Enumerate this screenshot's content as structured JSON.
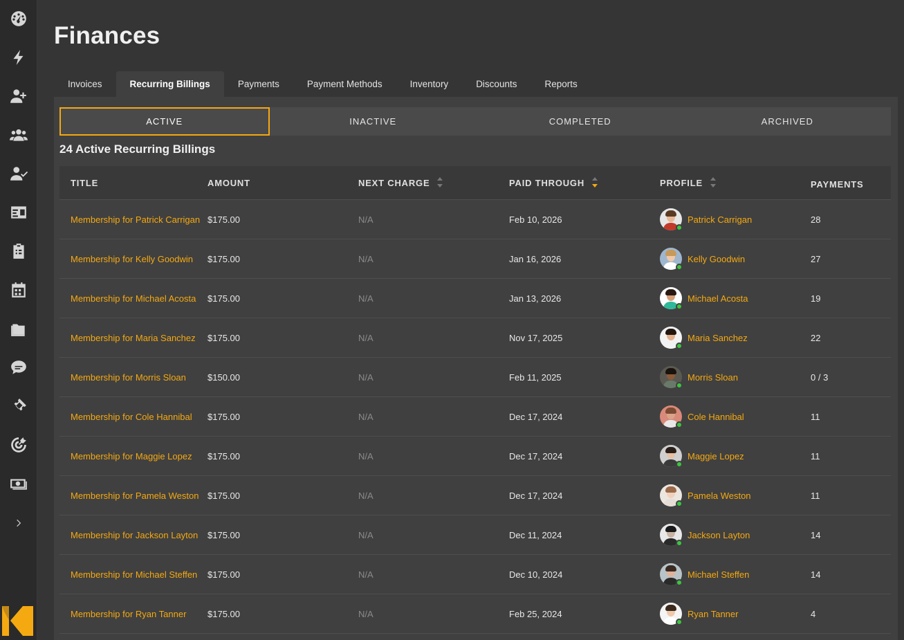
{
  "app": {
    "title": "Finances"
  },
  "sidebar": {
    "icons": [
      "dashboard-icon",
      "lightning-icon",
      "add-user-icon",
      "users-icon",
      "user-check-icon",
      "id-card-icon",
      "clipboard-icon",
      "calendar-icon",
      "folder-icon",
      "chat-icon",
      "ticket-icon",
      "target-icon",
      "money-icon",
      "chevron-right-icon"
    ]
  },
  "tabs": [
    {
      "label": "Invoices",
      "active": false
    },
    {
      "label": "Recurring Billings",
      "active": true
    },
    {
      "label": "Payments",
      "active": false
    },
    {
      "label": "Payment Methods",
      "active": false
    },
    {
      "label": "Inventory",
      "active": false
    },
    {
      "label": "Discounts",
      "active": false
    },
    {
      "label": "Reports",
      "active": false
    }
  ],
  "subtabs": [
    {
      "label": "ACTIVE",
      "active": true
    },
    {
      "label": "INACTIVE",
      "active": false
    },
    {
      "label": "COMPLETED",
      "active": false
    },
    {
      "label": "ARCHIVED",
      "active": false
    }
  ],
  "section": {
    "title": "24 Active Recurring Billings"
  },
  "table": {
    "columns": [
      "TITLE",
      "AMOUNT",
      "NEXT CHARGE",
      "PAID THROUGH",
      "PROFILE",
      "PAYMENTS"
    ],
    "rows": [
      {
        "title": "Membership for Patrick Carrigan",
        "amount": "$175.00",
        "next_charge": "N/A",
        "paid_through": "Feb 10, 2026",
        "profile": "Patrick Carrigan",
        "payments": "28",
        "skin": "#e8b896",
        "hair": "#5a3a22",
        "shirt": "#c23a2a",
        "bg": "#e6e6e6"
      },
      {
        "title": "Membership for Kelly Goodwin",
        "amount": "$175.00",
        "next_charge": "N/A",
        "paid_through": "Jan 16, 2026",
        "profile": "Kelly Goodwin",
        "payments": "27",
        "skin": "#f0c9a8",
        "hair": "#c79a5a",
        "shirt": "#ffffff",
        "bg": "#9fb6cf"
      },
      {
        "title": "Membership for Michael Acosta",
        "amount": "$175.00",
        "next_charge": "N/A",
        "paid_through": "Jan 13, 2026",
        "profile": "Michael Acosta",
        "payments": "19",
        "skin": "#d7a07a",
        "hair": "#2a1a12",
        "shirt": "#2fb89a",
        "bg": "#ffffff"
      },
      {
        "title": "Membership for Maria Sanchez",
        "amount": "$175.00",
        "next_charge": "N/A",
        "paid_through": "Nov 17, 2025",
        "profile": "Maria Sanchez",
        "payments": "22",
        "skin": "#e2b08c",
        "hair": "#221611",
        "shirt": "#f2f2f2",
        "bg": "#f2f2f2"
      },
      {
        "title": "Membership for Morris Sloan",
        "amount": "$150.00",
        "next_charge": "N/A",
        "paid_through": "Feb 11, 2025",
        "profile": "Morris Sloan",
        "payments": "0 / 3",
        "skin": "#8a5a3a",
        "hair": "#1a120c",
        "shirt": "#6a7a6a",
        "bg": "#5a5a52"
      },
      {
        "title": "Membership for Cole Hannibal",
        "amount": "$175.00",
        "next_charge": "N/A",
        "paid_through": "Dec 17, 2024",
        "profile": "Cole Hannibal",
        "payments": "11",
        "skin": "#d9a48a",
        "hair": "#7a4a32",
        "shirt": "#e8e8e8",
        "bg": "#d98a7a"
      },
      {
        "title": "Membership for Maggie Lopez",
        "amount": "$175.00",
        "next_charge": "N/A",
        "paid_through": "Dec 17, 2024",
        "profile": "Maggie Lopez",
        "payments": "11",
        "skin": "#e6c0a4",
        "hair": "#2a1e18",
        "shirt": "#3a3a3a",
        "bg": "#cfcfcf"
      },
      {
        "title": "Membership for Pamela Weston",
        "amount": "$175.00",
        "next_charge": "N/A",
        "paid_through": "Dec 17, 2024",
        "profile": "Pamela Weston",
        "payments": "11",
        "skin": "#f0d2bc",
        "hair": "#9a6a4a",
        "shirt": "#e6ded6",
        "bg": "#ece6e0"
      },
      {
        "title": "Membership for Jackson Layton",
        "amount": "$175.00",
        "next_charge": "N/A",
        "paid_through": "Dec 11, 2024",
        "profile": "Jackson Layton",
        "payments": "14",
        "skin": "#c9b4a4",
        "hair": "#1a1a1a",
        "shirt": "#2a2a2a",
        "bg": "#e8e8e8"
      },
      {
        "title": "Membership for Michael Steffen",
        "amount": "$175.00",
        "next_charge": "N/A",
        "paid_through": "Dec 10, 2024",
        "profile": "Michael Steffen",
        "payments": "14",
        "skin": "#e0b49a",
        "hair": "#3a2a22",
        "shirt": "#2a2a2a",
        "bg": "#b8c4c8"
      },
      {
        "title": "Membership for Ryan Tanner",
        "amount": "$175.00",
        "next_charge": "N/A",
        "paid_through": "Feb 25, 2024",
        "profile": "Ryan Tanner",
        "payments": "4",
        "skin": "#f0c8aa",
        "hair": "#3a2a1e",
        "shirt": "#ffffff",
        "bg": "#f4f4f4"
      }
    ]
  },
  "colors": {
    "accent": "#f5a911",
    "online": "#3cc640"
  }
}
